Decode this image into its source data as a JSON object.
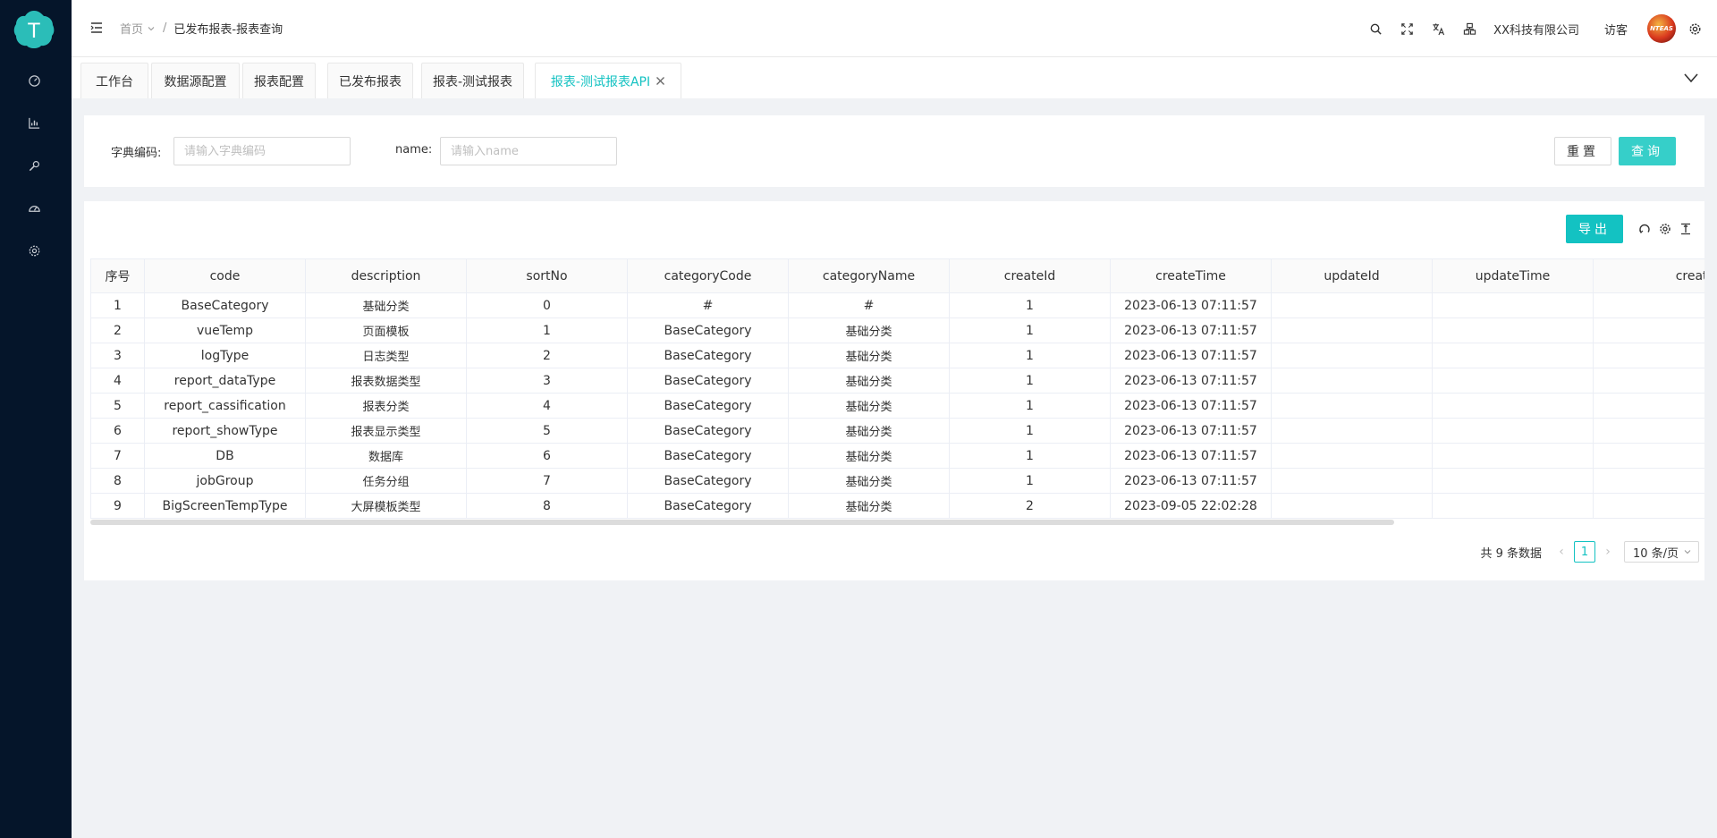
{
  "header": {
    "breadcrumb": {
      "home": "首页",
      "current": "已发布报表-报表查询"
    },
    "company": "XX科技有限公司",
    "user": "访客",
    "avatar_text": "NTEAS"
  },
  "sidebar": {
    "logo_letter": "T",
    "items": [
      "dashboard-icon",
      "chart-icon",
      "tools-icon",
      "speed-icon",
      "settings-icon"
    ]
  },
  "tabs": [
    {
      "label": "工作台"
    },
    {
      "label": "数据源配置"
    },
    {
      "label": "报表配置"
    },
    {
      "label": "已发布报表"
    },
    {
      "label": "报表-测试报表"
    },
    {
      "label": "报表-测试报表API",
      "active": true
    }
  ],
  "search": {
    "dict_code_label": "字典编码:",
    "dict_code_placeholder": "请输入字典编码",
    "name_label": "name:",
    "name_placeholder": "请输入name",
    "reset_label": "重置",
    "query_label": "查询"
  },
  "toolbar": {
    "export_label": "导出"
  },
  "table": {
    "columns": [
      "序号",
      "code",
      "description",
      "sortNo",
      "categoryCode",
      "categoryName",
      "createId",
      "createTime",
      "updateId",
      "updateTime",
      "createUse"
    ],
    "rows": [
      [
        "1",
        "BaseCategory",
        "基础分类",
        "0",
        "#",
        "#",
        "1",
        "2023-06-13 07:11:57",
        "",
        "",
        ""
      ],
      [
        "2",
        "vueTemp",
        "页面模板",
        "1",
        "BaseCategory",
        "基础分类",
        "1",
        "2023-06-13 07:11:57",
        "",
        "",
        ""
      ],
      [
        "3",
        "logType",
        "日志类型",
        "2",
        "BaseCategory",
        "基础分类",
        "1",
        "2023-06-13 07:11:57",
        "",
        "",
        ""
      ],
      [
        "4",
        "report_dataType",
        "报表数据类型",
        "3",
        "BaseCategory",
        "基础分类",
        "1",
        "2023-06-13 07:11:57",
        "",
        "",
        ""
      ],
      [
        "5",
        "report_cassification",
        "报表分类",
        "4",
        "BaseCategory",
        "基础分类",
        "1",
        "2023-06-13 07:11:57",
        "",
        "",
        ""
      ],
      [
        "6",
        "report_showType",
        "报表显示类型",
        "5",
        "BaseCategory",
        "基础分类",
        "1",
        "2023-06-13 07:11:57",
        "",
        "",
        ""
      ],
      [
        "7",
        "DB",
        "数据库",
        "6",
        "BaseCategory",
        "基础分类",
        "1",
        "2023-06-13 07:11:57",
        "",
        "",
        ""
      ],
      [
        "8",
        "jobGroup",
        "任务分组",
        "7",
        "BaseCategory",
        "基础分类",
        "1",
        "2023-06-13 07:11:57",
        "",
        "",
        ""
      ],
      [
        "9",
        "BigScreenTempType",
        "大屏模板类型",
        "8",
        "BaseCategory",
        "基础分类",
        "2",
        "2023-09-05 22:02:28",
        "",
        "",
        ""
      ]
    ]
  },
  "pagination": {
    "total_text": "共 9 条数据",
    "current_page": "1",
    "page_size": "10 条/页"
  },
  "colors": {
    "accent": "#13c2c2",
    "sidebar_bg": "#05152a"
  }
}
